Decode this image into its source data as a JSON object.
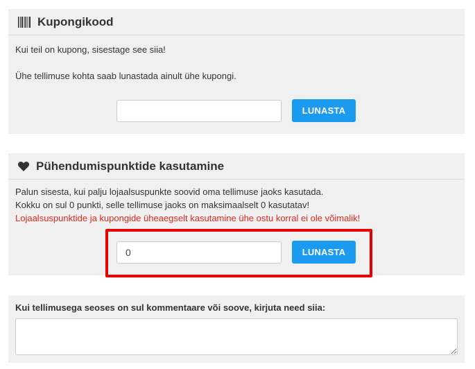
{
  "coupon": {
    "title": "Kupongikood",
    "icon": "barcode-icon",
    "line1": "Kui teil on kupong, sisestage see siia!",
    "line2": "Ühe tellimuse kohta saab lunastada ainult ühe kupongi.",
    "input_value": "",
    "button_label": "LUNASTA"
  },
  "loyalty": {
    "title": "Pühendumispunktide kasutamine",
    "icon": "heart-icon",
    "line1": "Palun sisesta, kui palju lojaalsuspunkte soovid oma tellimuse jaoks kasutada.",
    "line2": "Kokku on sul 0 punkti, selle tellimuse jaoks on maksimaalselt 0 kasutatav!",
    "warning": "Lojaalsuspunktide ja kupongide üheaegselt kasutamine ühe ostu korral ei ole võimalik!",
    "input_value": "0",
    "button_label": "LUNASTA"
  },
  "comment": {
    "label": "Kui tellimusega seoses on sul kommentaare või soove, kirjuta need siia:",
    "value": ""
  },
  "colors": {
    "button": "#1a9bf0",
    "warning": "#e0281e",
    "highlight": "#ea0000",
    "panel": "#f0f0f0"
  }
}
